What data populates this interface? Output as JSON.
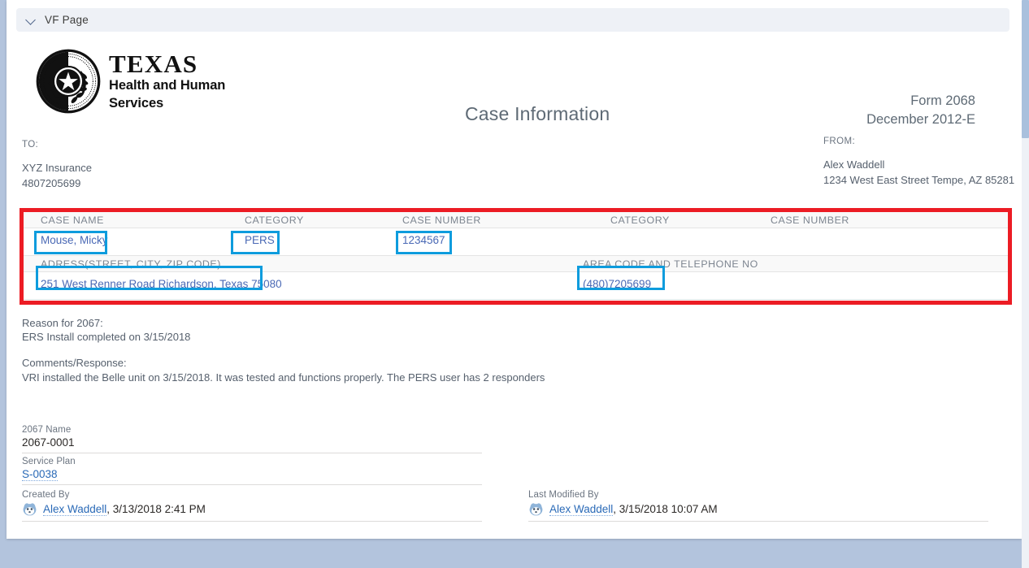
{
  "window": {
    "panel_title": "VF Page",
    "chevron_icon": "chevron-down-icon"
  },
  "logo": {
    "seal_icon": "texas-state-seal-icon",
    "line1": "TEXAS",
    "line2": "Health and Human",
    "line3": "Services"
  },
  "document": {
    "title": "Case Information",
    "form_number": "Form 2068",
    "form_date": "December 2012-E"
  },
  "addresses": {
    "to": {
      "label": "TO:",
      "line1": "XYZ Insurance",
      "line2": "4807205699"
    },
    "from": {
      "label": "FROM:",
      "line1": "Alex Waddell",
      "line2": "1234 West East Street Tempe, AZ 85281"
    }
  },
  "case_table": {
    "headers": {
      "case_name": "CASE NAME",
      "category": "CATEGORY",
      "case_number": "CASE NUMBER",
      "category2": "CATEGORY",
      "case_number2": "CASE NUMBER",
      "address": "ADRESS(STREET, CITY, ZIP CODE)",
      "telephone": "AREA CODE AND TELEPHONE NO"
    },
    "values": {
      "case_name": "Mouse, Micky",
      "category": "PERS",
      "case_number": "1234567",
      "category2": "",
      "case_number2": "",
      "address": "251 West Renner Road Richardson, Texas 75080",
      "telephone": "(480)7205699"
    },
    "highlight_border_color": "#ec1c24",
    "annotation_border_color": "#0e9cdd"
  },
  "narrative": {
    "reason_label": "Reason for 2067:",
    "reason_value": "ERS Install completed on 3/15/2018",
    "comments_label": "Comments/Response:",
    "comments_value": "VRI installed the Belle unit on 3/15/2018. It was tested and functions properly. The PERS user has 2 responders"
  },
  "record_fields": {
    "name_2067": {
      "label": "2067 Name",
      "value": "2067-0001"
    },
    "service_plan": {
      "label": "Service Plan",
      "value": "S-0038"
    },
    "created_by": {
      "label": "Created By",
      "user": "Alex Waddell",
      "timestamp": ", 3/13/2018 2:41 PM",
      "avatar_icon": "user-avatar-icon"
    },
    "last_modified_by": {
      "label": "Last Modified By",
      "user": "Alex Waddell",
      "timestamp": ", 3/15/2018 10:07 AM",
      "avatar_icon": "user-avatar-icon"
    }
  }
}
